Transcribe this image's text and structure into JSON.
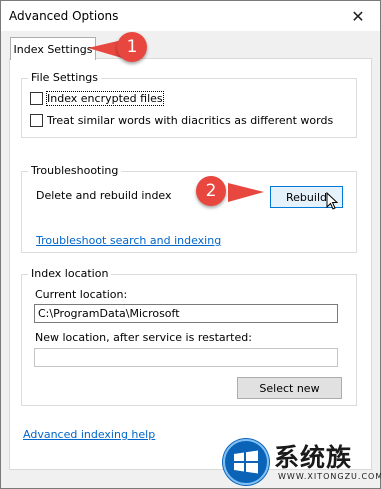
{
  "window": {
    "title": "Advanced Options",
    "close_glyph": "✕"
  },
  "tabs": [
    {
      "label": "Index Settings",
      "selected": true
    }
  ],
  "file_settings": {
    "legend": "File Settings",
    "options": [
      {
        "label": "Index encrypted files",
        "checked": false
      },
      {
        "label": "Treat similar words with diacritics as different words",
        "checked": false
      }
    ]
  },
  "troubleshooting": {
    "legend": "Troubleshooting",
    "rebuild_prompt": "Delete and rebuild index",
    "rebuild_button": "Rebuild",
    "troubleshoot_link": "Troubleshoot search and indexing"
  },
  "index_location": {
    "legend": "Index location",
    "current_label": "Current location:",
    "current_value": "C:\\ProgramData\\Microsoft",
    "new_label": "New location, after service is restarted:",
    "new_value": "",
    "select_button": "Select new"
  },
  "footer": {
    "help_link": "Advanced indexing help"
  },
  "callouts": [
    {
      "number": "1",
      "color": "#e8473f"
    },
    {
      "number": "2",
      "color": "#e8473f"
    }
  ],
  "watermark": {
    "brand": "系统族",
    "url": "WWW.XITONGZU.COM",
    "logo_color": "#0b63b8"
  }
}
